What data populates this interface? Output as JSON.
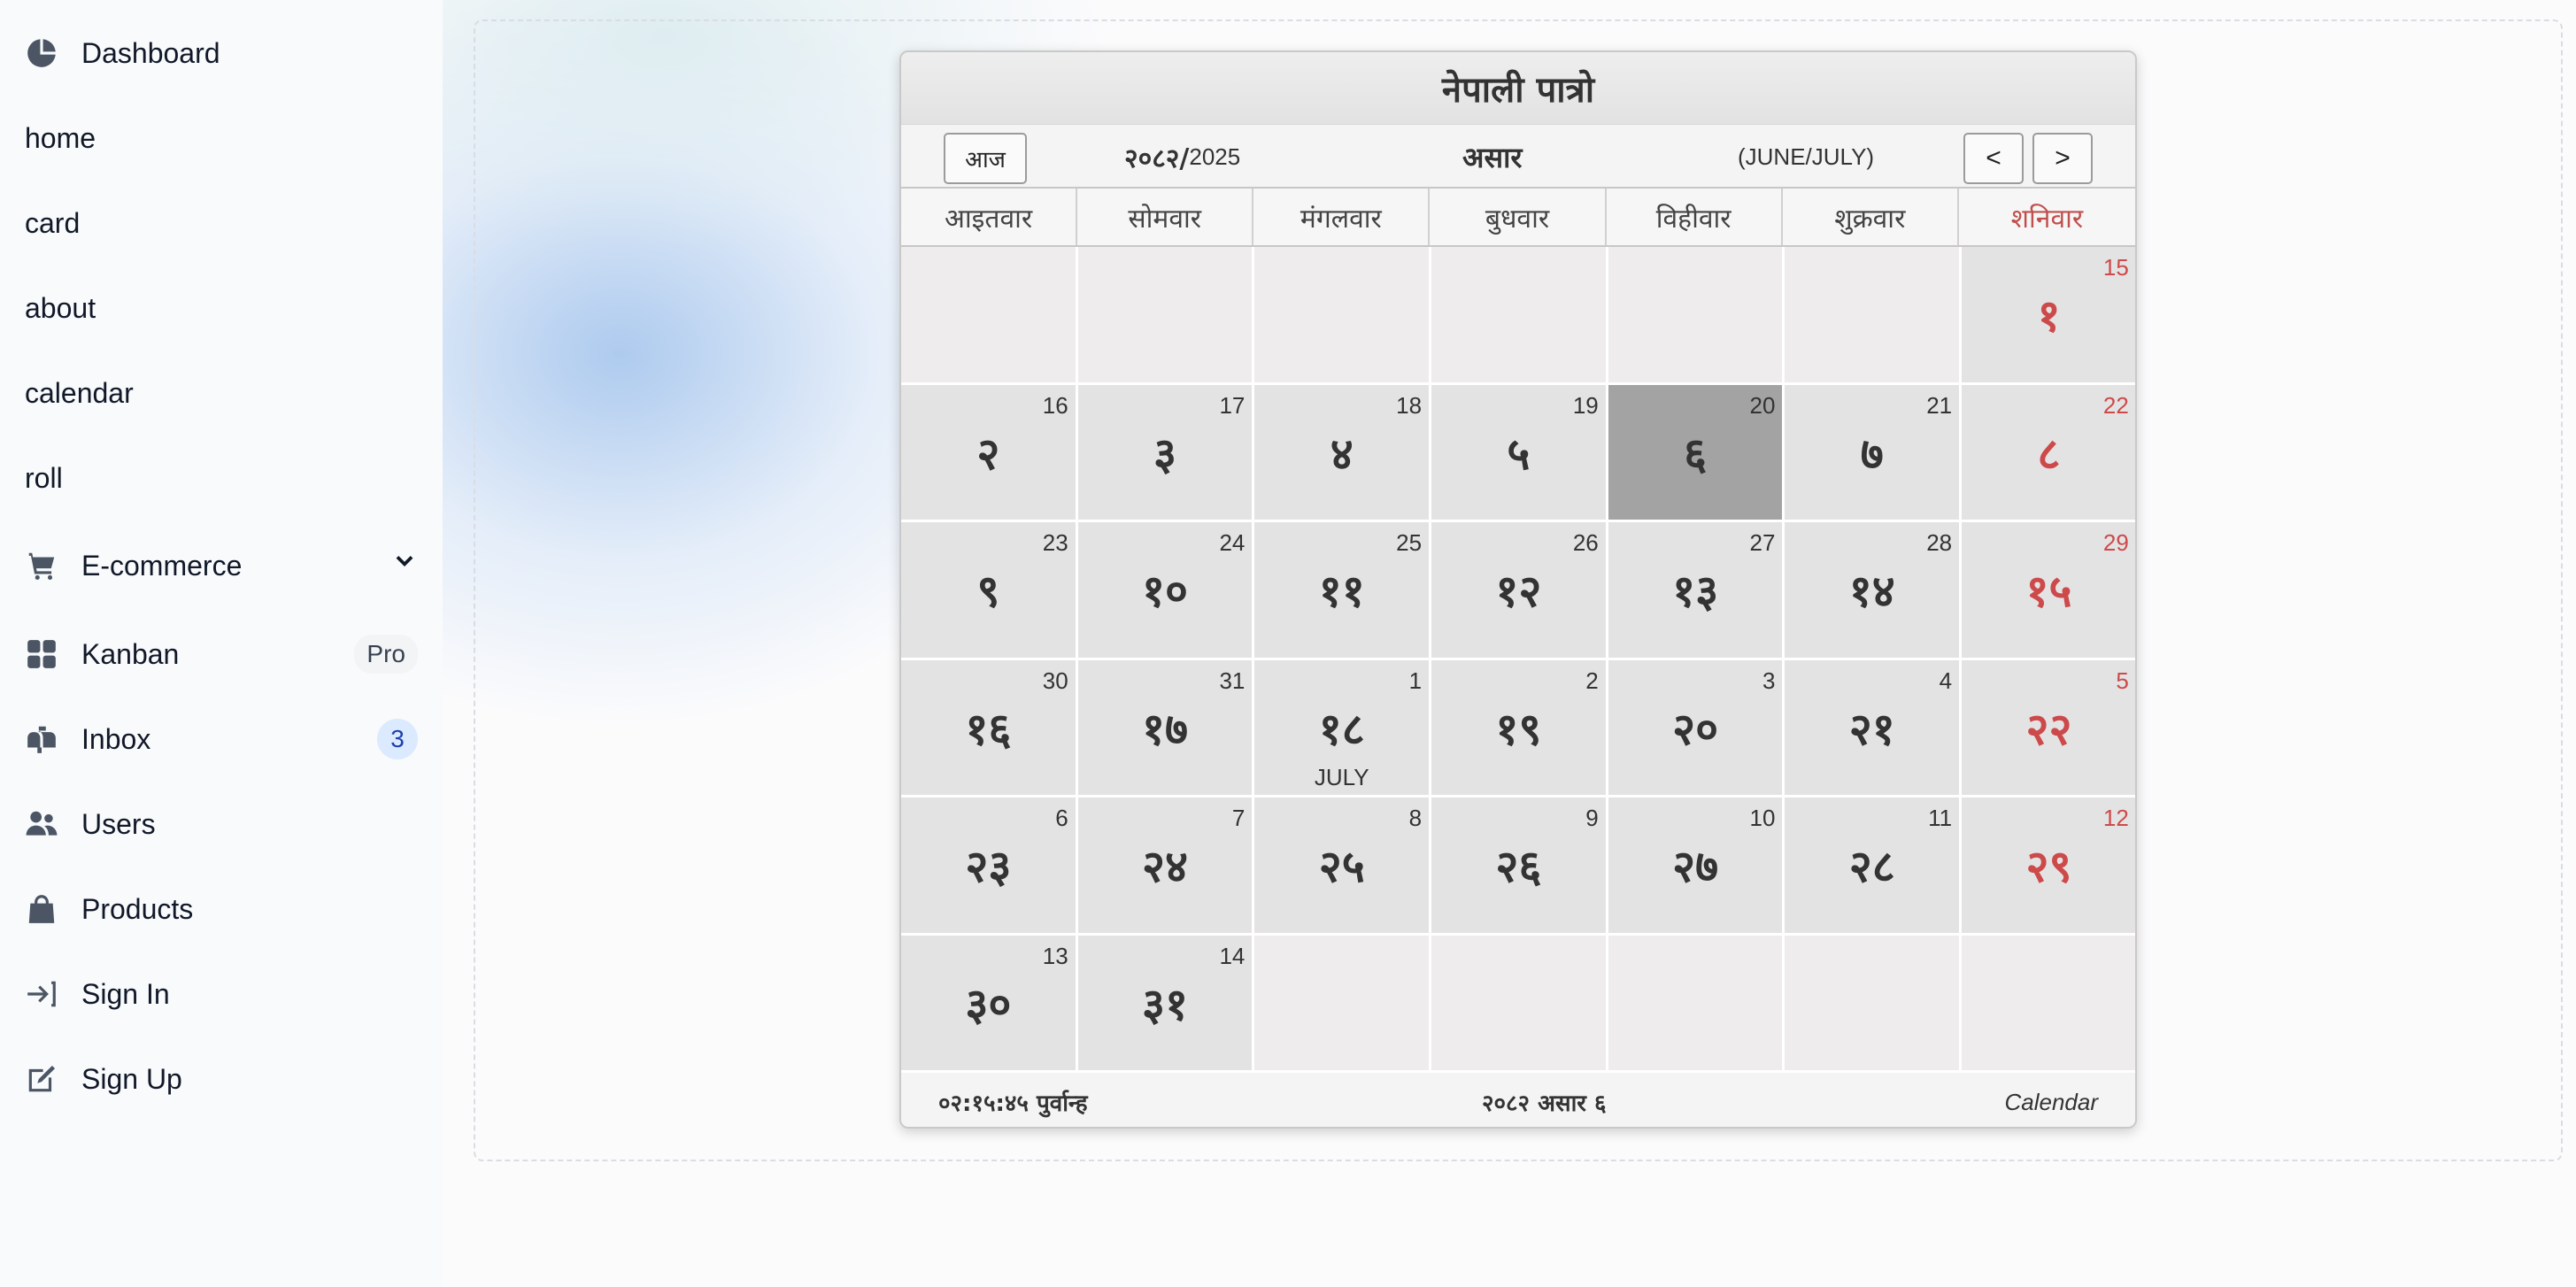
{
  "sidebar": {
    "items": [
      {
        "label": "Dashboard",
        "icon": "pie-chart-icon"
      },
      {
        "label": "home"
      },
      {
        "label": "card"
      },
      {
        "label": "about"
      },
      {
        "label": "calendar"
      },
      {
        "label": "roll"
      },
      {
        "label": "E-commerce",
        "icon": "cart-icon"
      },
      {
        "label": "Kanban",
        "icon": "grid-icon",
        "badge": "Pro"
      },
      {
        "label": "Inbox",
        "icon": "mailbox-icon",
        "badge": "3"
      },
      {
        "label": "Users",
        "icon": "users-icon"
      },
      {
        "label": "Products",
        "icon": "shopping-bag-icon"
      },
      {
        "label": "Sign In",
        "icon": "sign-in-icon"
      },
      {
        "label": "Sign Up",
        "icon": "edit-icon"
      }
    ]
  },
  "calendar": {
    "title": "नेपाली पात्रो",
    "today_button": "आज",
    "year_np": "२०८२/",
    "year_en": "2025",
    "month_np": "असार",
    "months_en": "(JUNE/JULY)",
    "prev_label": "<",
    "next_label": ">",
    "weekdays": [
      "आइतवार",
      "सोमवार",
      "मंगलवार",
      "बुधवार",
      "विहीवार",
      "शुक्रवार",
      "शनिवार"
    ],
    "leading_blanks": 6,
    "days": [
      {
        "np": "१",
        "en": "15"
      },
      {
        "np": "२",
        "en": "16"
      },
      {
        "np": "३",
        "en": "17"
      },
      {
        "np": "४",
        "en": "18"
      },
      {
        "np": "५",
        "en": "19"
      },
      {
        "np": "६",
        "en": "20"
      },
      {
        "np": "७",
        "en": "21"
      },
      {
        "np": "८",
        "en": "22"
      },
      {
        "np": "९",
        "en": "23"
      },
      {
        "np": "१०",
        "en": "24"
      },
      {
        "np": "११",
        "en": "25"
      },
      {
        "np": "१२",
        "en": "26"
      },
      {
        "np": "१३",
        "en": "27"
      },
      {
        "np": "१४",
        "en": "28"
      },
      {
        "np": "१५",
        "en": "29"
      },
      {
        "np": "१६",
        "en": "30"
      },
      {
        "np": "१७",
        "en": "31"
      },
      {
        "np": "१८",
        "en": "1",
        "month_label": "JULY"
      },
      {
        "np": "१९",
        "en": "2"
      },
      {
        "np": "२०",
        "en": "3"
      },
      {
        "np": "२१",
        "en": "4"
      },
      {
        "np": "२२",
        "en": "5"
      },
      {
        "np": "२३",
        "en": "6"
      },
      {
        "np": "२४",
        "en": "7"
      },
      {
        "np": "२५",
        "en": "8"
      },
      {
        "np": "२६",
        "en": "9"
      },
      {
        "np": "२७",
        "en": "10"
      },
      {
        "np": "२८",
        "en": "11"
      },
      {
        "np": "२९",
        "en": "12"
      },
      {
        "np": "३०",
        "en": "13"
      },
      {
        "np": "३१",
        "en": "14"
      }
    ],
    "today_index": 5,
    "total_cells": 42,
    "footer_time": "०२:१५:४५ पुर्वान्ह",
    "footer_date": "२०८२ असार ६",
    "footer_brand": "Calendar",
    "colors": {
      "saturday": "#cd4a4a",
      "today_bg": "#a3a3a3",
      "day_bg": "#e4e3e4"
    }
  }
}
